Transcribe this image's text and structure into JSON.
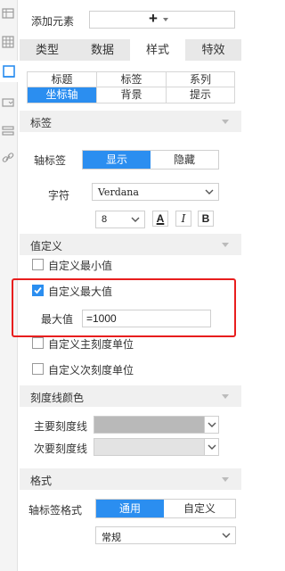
{
  "add_element": {
    "label": "添加元素",
    "plus": "+"
  },
  "main_tabs": [
    "类型",
    "数据",
    "样式",
    "特效"
  ],
  "main_tab_active": "样式",
  "sub_tabs": [
    [
      "标题",
      "标签",
      "系列"
    ],
    [
      "坐标轴",
      "背景",
      "提示"
    ]
  ],
  "sub_tab_active": "坐标轴",
  "sections": {
    "label": "标签",
    "value_def": "值定义",
    "grid_color": "刻度线颜色",
    "format": "格式"
  },
  "axis_label": {
    "label": "轴标签",
    "options": [
      "显示",
      "隐藏"
    ],
    "active": "显示"
  },
  "font": {
    "label": "字符",
    "family": "Verdana",
    "size": "8",
    "buttons": [
      "A",
      "I",
      "B"
    ]
  },
  "value_def": {
    "custom_min": {
      "label": "自定义最小值",
      "checked": false
    },
    "custom_max": {
      "label": "自定义最大值",
      "checked": true
    },
    "max_value": {
      "label": "最大值",
      "value": "=1000"
    },
    "custom_major": {
      "label": "自定义主刻度单位",
      "checked": false
    },
    "custom_minor": {
      "label": "自定义次刻度单位",
      "checked": false
    }
  },
  "grid_color": {
    "major": {
      "label": "主要刻度线",
      "color": "#b9b9b9"
    },
    "minor": {
      "label": "次要刻度线",
      "color": "#e3e3e3"
    }
  },
  "format": {
    "label": "轴标签格式",
    "options": [
      "通用",
      "自定义"
    ],
    "active": "通用",
    "type": "常规"
  },
  "icons": {
    "rail": [
      "table-icon",
      "grid-icon",
      "chart-icon",
      "dropdown-icon",
      "list-icon",
      "link-icon"
    ],
    "chevron": "chevron-down-icon"
  },
  "colors": {
    "accent": "#2b8ef0",
    "highlight": "#e81e1e",
    "section_bg": "#f0f0f0",
    "tab_bar_bg": "#e8e8e8"
  }
}
